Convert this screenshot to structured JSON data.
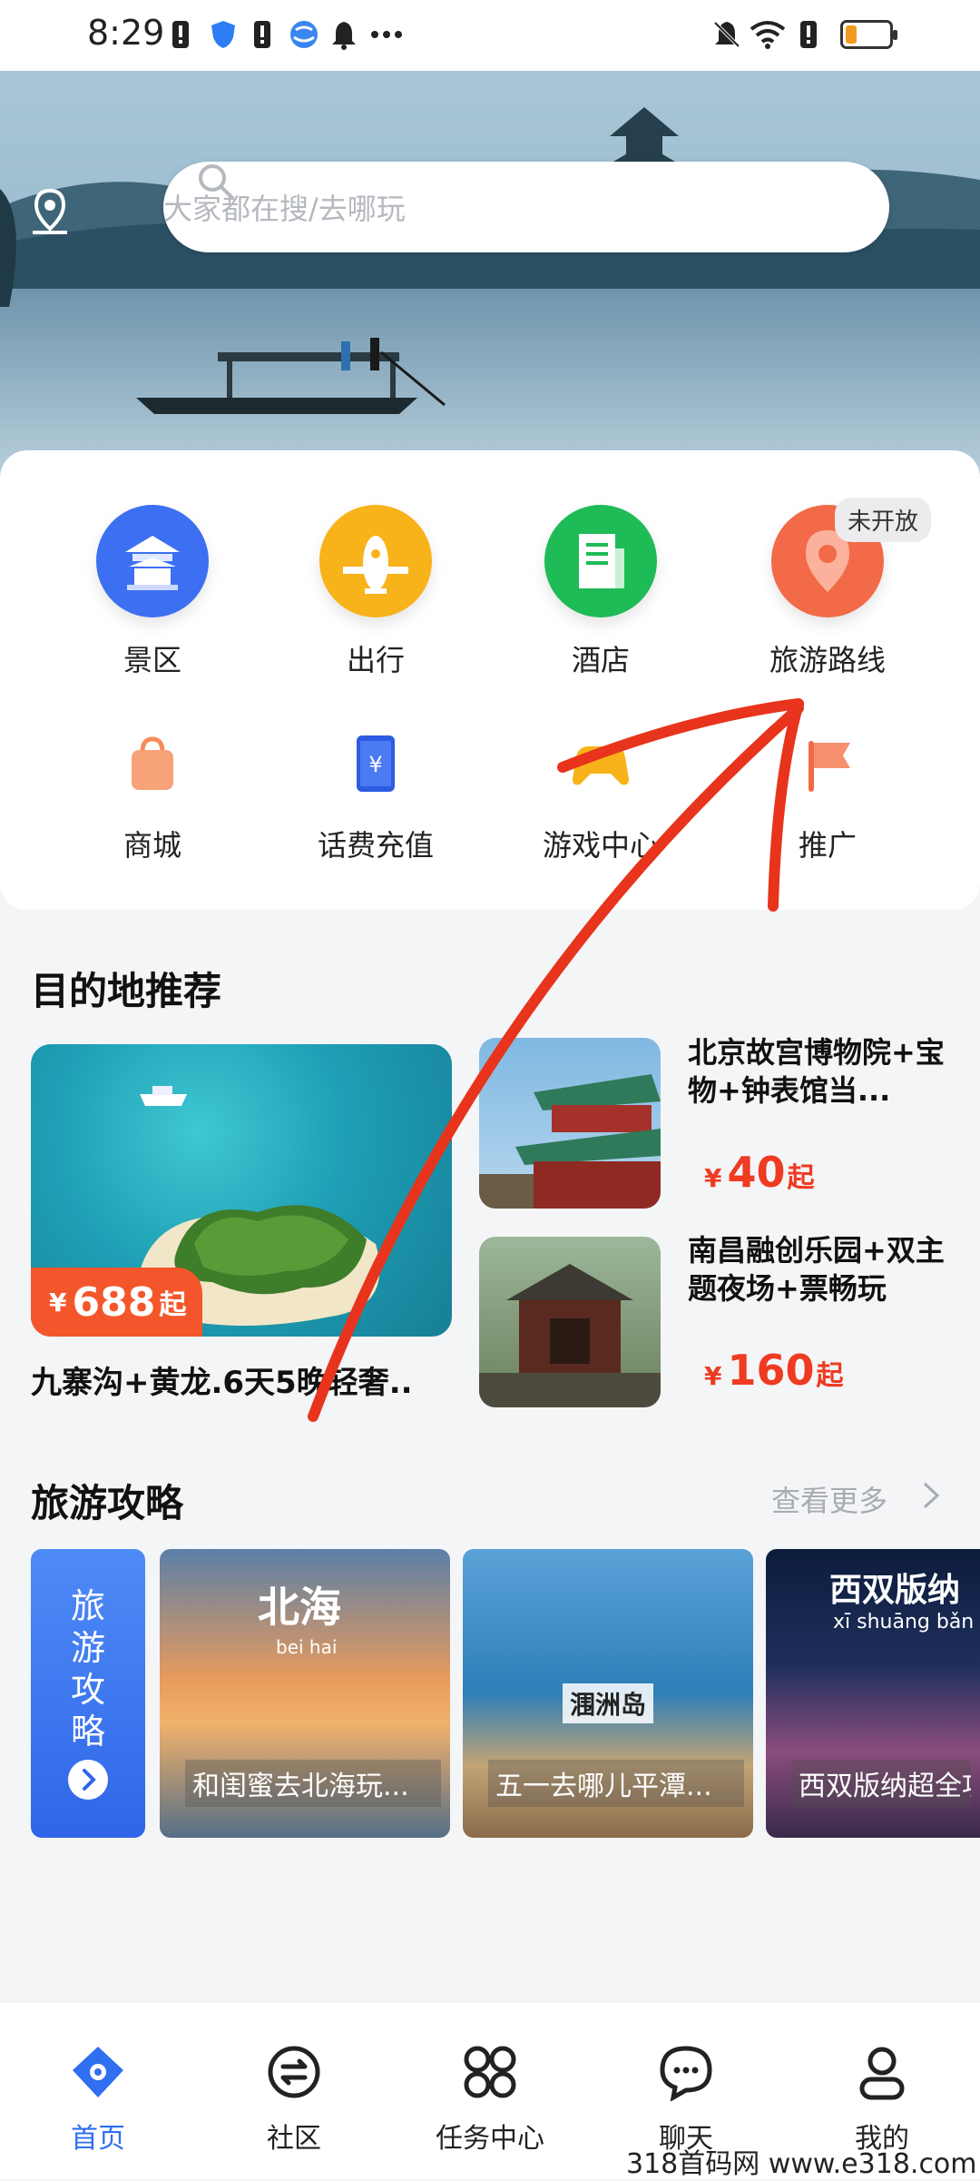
{
  "status_bar": {
    "time": "8:29",
    "status_icons": [
      "warning-icon",
      "shield-icon",
      "warning-icon",
      "globe-icon",
      "bell-icon",
      "more-icon"
    ],
    "right_icons": [
      "mute-icon",
      "wifi-icon",
      "warning-icon"
    ],
    "battery_level": 0.25
  },
  "search": {
    "placeholder": "大家都在搜/去哪玩"
  },
  "menu": {
    "row1": [
      {
        "label": "景区",
        "icon": "temple-icon",
        "color": "#3d6ff2"
      },
      {
        "label": "出行",
        "icon": "plane-icon",
        "color": "#f8b21a"
      },
      {
        "label": "酒店",
        "icon": "hotel-icon",
        "color": "#1fbb57"
      },
      {
        "label": "旅游路线",
        "icon": "route-pin-icon",
        "color": "#f26a47"
      }
    ],
    "badge": "未开放",
    "row2": [
      {
        "label": "商城",
        "icon": "shopping-bag-icon"
      },
      {
        "label": "话费充值",
        "icon": "recharge-icon"
      },
      {
        "label": "游戏中心",
        "icon": "gamepad-icon"
      },
      {
        "label": "推广",
        "icon": "promo-flag-icon"
      }
    ]
  },
  "destinations": {
    "title": "目的地推荐",
    "featured": {
      "title": "九寨沟+黄龙.6天5晚轻奢..",
      "price_symbol": "¥",
      "price": "688",
      "price_suffix": "起"
    },
    "items": [
      {
        "title": "北京故宫博物院+宝物+钟表馆当...",
        "price_symbol": "¥",
        "price": "40",
        "price_suffix": "起"
      },
      {
        "title": "南昌融创乐园+双主题夜场+票畅玩",
        "price_symbol": "¥",
        "price": "160",
        "price_suffix": "起"
      }
    ]
  },
  "guides": {
    "title": "旅游攻略",
    "more": "查看更多",
    "side_label": "旅游攻略",
    "cards": [
      {
        "title": "北海",
        "subtitle": "bei hai",
        "caption": "和闺蜜去北海玩..."
      },
      {
        "title": "涠洲岛",
        "caption": "五一去哪儿平潭..."
      },
      {
        "title": "西双版纳",
        "subtitle": "xī shuāng bǎn nà",
        "caption": "西双版纳超全攻略"
      }
    ]
  },
  "nav": [
    {
      "label": "首页",
      "icon": "home-icon",
      "active": true
    },
    {
      "label": "社区",
      "icon": "community-icon"
    },
    {
      "label": "任务中心",
      "icon": "task-center-icon"
    },
    {
      "label": "聊天",
      "icon": "chat-icon"
    },
    {
      "label": "我的",
      "icon": "profile-icon"
    }
  ],
  "watermark": "318首码网  www.e318.com"
}
